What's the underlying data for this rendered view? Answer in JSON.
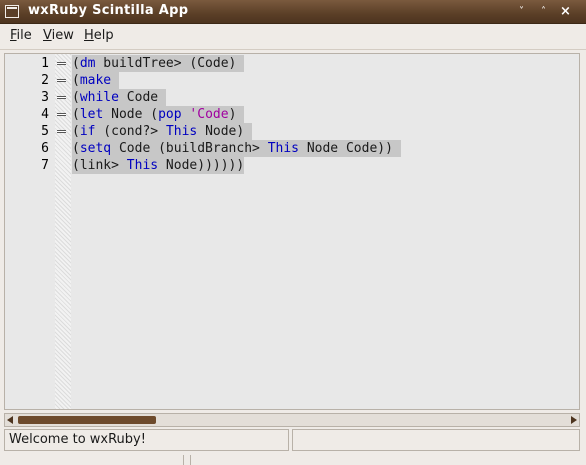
{
  "window": {
    "title": "wxRuby Scintilla App",
    "buttons": {
      "minimize": "˅",
      "maximize": "˄",
      "close": "×"
    }
  },
  "menubar": {
    "items": [
      {
        "label": "File",
        "underline": "F",
        "rest": "ile"
      },
      {
        "label": "View",
        "underline": "V",
        "rest": "iew"
      },
      {
        "label": "Help",
        "underline": "H",
        "rest": "elp"
      }
    ]
  },
  "editor": {
    "lines": [
      {
        "num": "1",
        "fold": true,
        "tokens": [
          {
            "t": "(",
            "c": "p"
          },
          {
            "t": "dm",
            "c": "kw"
          },
          {
            "t": " buildTree> (Code) ",
            "c": "p"
          }
        ]
      },
      {
        "num": "2",
        "fold": true,
        "tokens": [
          {
            "t": "(",
            "c": "p"
          },
          {
            "t": "make",
            "c": "kw"
          },
          {
            "t": " ",
            "c": "p"
          }
        ]
      },
      {
        "num": "3",
        "fold": true,
        "tokens": [
          {
            "t": "(",
            "c": "p"
          },
          {
            "t": "while",
            "c": "kw"
          },
          {
            "t": " Code ",
            "c": "p"
          }
        ]
      },
      {
        "num": "4",
        "fold": true,
        "tokens": [
          {
            "t": "(",
            "c": "p"
          },
          {
            "t": "let",
            "c": "kw"
          },
          {
            "t": " Node (",
            "c": "p"
          },
          {
            "t": "pop",
            "c": "kw"
          },
          {
            "t": " ",
            "c": "p"
          },
          {
            "t": "'Code",
            "c": "qt"
          },
          {
            "t": ") ",
            "c": "p"
          }
        ]
      },
      {
        "num": "5",
        "fold": true,
        "tokens": [
          {
            "t": "(",
            "c": "p"
          },
          {
            "t": "if",
            "c": "kw"
          },
          {
            "t": " (cond?> ",
            "c": "p"
          },
          {
            "t": "This",
            "c": "kw"
          },
          {
            "t": " Node) ",
            "c": "p"
          }
        ]
      },
      {
        "num": "6",
        "fold": false,
        "tokens": [
          {
            "t": "(",
            "c": "p"
          },
          {
            "t": "setq",
            "c": "kw"
          },
          {
            "t": " Code (buildBranch> ",
            "c": "p"
          },
          {
            "t": "This",
            "c": "kw"
          },
          {
            "t": " Node Code)) ",
            "c": "p"
          }
        ]
      },
      {
        "num": "7",
        "fold": false,
        "tokens": [
          {
            "t": "(link> ",
            "c": "p"
          },
          {
            "t": "This",
            "c": "kw"
          },
          {
            "t": " Node))))))",
            "c": "p"
          }
        ]
      }
    ]
  },
  "statusbar": {
    "text": "Welcome to wxRuby!",
    "field2": ""
  },
  "colors": {
    "titlebar": "#5b3f27",
    "keyword": "#0000c0",
    "quoted": "#a000a0",
    "selection": "#c7c7c7",
    "scroll_thumb": "#6d4a2c"
  }
}
